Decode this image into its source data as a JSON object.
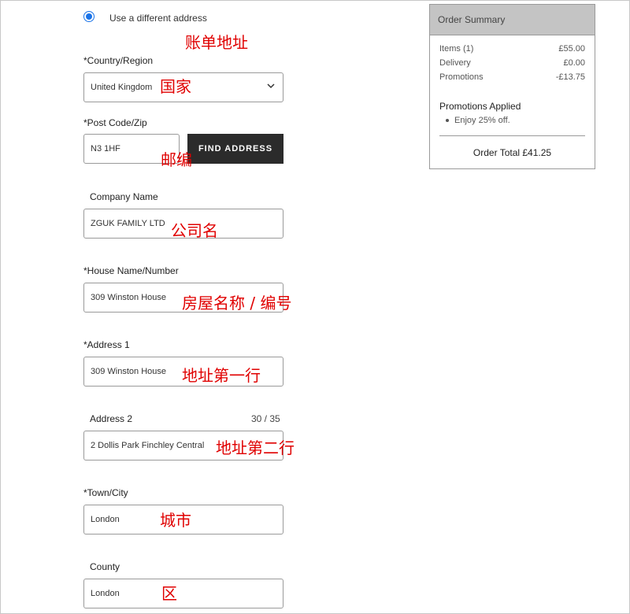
{
  "billing": {
    "radio_label": "Use a different address",
    "annotation_title": "账单地址",
    "country": {
      "label": "*Country/Region",
      "value": "United Kingdom",
      "annotation": "国家"
    },
    "postcode": {
      "label": "*Post Code/Zip",
      "value": "N3 1HF",
      "button": "FIND ADDRESS",
      "annotation": "邮编"
    },
    "company": {
      "label": "Company Name",
      "value": "ZGUK FAMILY LTD",
      "annotation": "公司名"
    },
    "house": {
      "label": "*House Name/Number",
      "value": "309 Winston House",
      "annotation": "房屋名称 / 编号"
    },
    "address1": {
      "label": "*Address 1",
      "value": "309 Winston House",
      "annotation": "地址第一行"
    },
    "address2": {
      "label": "Address 2",
      "counter": "30 / 35",
      "value": "2 Dollis Park Finchley Central",
      "annotation": "地址第二行"
    },
    "town": {
      "label": "*Town/City",
      "value": "London",
      "annotation": "城市"
    },
    "county": {
      "label": "County",
      "value": "London",
      "annotation": "区"
    }
  },
  "summary": {
    "title": "Order Summary",
    "items_label": "Items (1)",
    "items_value": "£55.00",
    "delivery_label": "Delivery",
    "delivery_value": "£0.00",
    "promotions_label": "Promotions",
    "promotions_value": "-£13.75",
    "promotions_applied_title": "Promotions Applied",
    "promotion_item": "Enjoy 25% off.",
    "order_total": "Order Total £41.25"
  },
  "colors": {
    "accent": "#1a73e8",
    "annotation": "#e00000",
    "button_bg": "#2b2b2b",
    "summary_header_bg": "#c4c4c4"
  }
}
